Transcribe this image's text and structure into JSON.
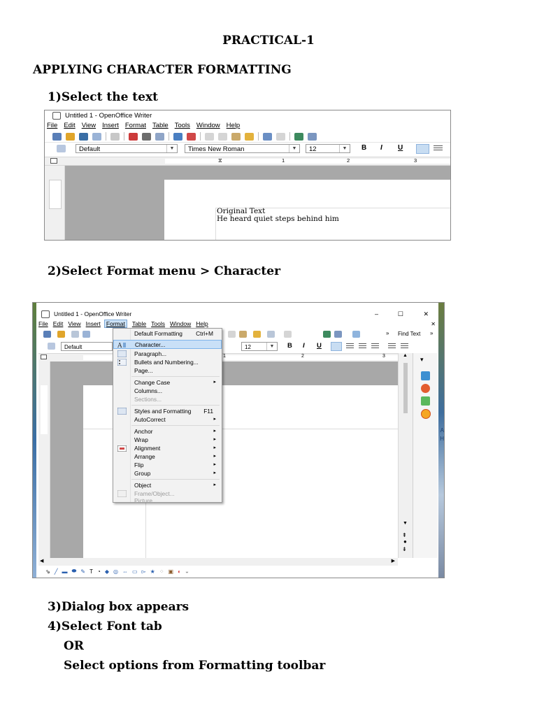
{
  "document": {
    "title": "PRACTICAL-1",
    "heading": "APPLYING CHARACTER FORMATTING",
    "steps": [
      {
        "num": "1)",
        "text": "Select the text"
      },
      {
        "num": "2)",
        "text": "Select Format menu > Character"
      },
      {
        "num": "3)",
        "text": "Dialog box appears"
      },
      {
        "num": "4)",
        "text": "Select Font tab"
      }
    ],
    "or_text": "OR",
    "alt_text": "Select options from Formatting toolbar"
  },
  "screenshot1": {
    "window_title": "Untitled 1 - OpenOffice Writer",
    "menu": [
      "File",
      "Edit",
      "View",
      "Insert",
      "Format",
      "Table",
      "Tools",
      "Window",
      "Help"
    ],
    "style_combo": "Default",
    "font_combo": "Times New Roman",
    "size_combo": "12",
    "bold": "B",
    "italic": "I",
    "underline": "U",
    "ruler_marks": [
      "1",
      "2",
      "3"
    ],
    "doc_lines": [
      "Original Text",
      "He heard quiet steps behind him"
    ]
  },
  "screenshot2": {
    "window_title": "Untitled 1 - OpenOffice Writer",
    "win_min": "–",
    "win_max": "☐",
    "win_close": "✕",
    "menu": [
      "File",
      "Edit",
      "View",
      "Insert",
      "Format",
      "Table",
      "Tools",
      "Window",
      "Help"
    ],
    "style_combo": "Default",
    "size_combo": "12",
    "find_text": "Find Text",
    "bold": "B",
    "italic": "I",
    "underline": "U",
    "ruler_marks": [
      "1",
      "2",
      "3"
    ],
    "format_menu": {
      "default_formatting": "Default Formatting",
      "default_shortcut": "Ctrl+M",
      "character": "Character...",
      "paragraph": "Paragraph...",
      "bullets": "Bullets and Numbering...",
      "page": "Page...",
      "change_case": "Change Case",
      "columns": "Columns...",
      "sections": "Sections...",
      "styles": "Styles and Formatting",
      "styles_shortcut": "F11",
      "autocorrect": "AutoCorrect",
      "anchor": "Anchor",
      "wrap": "Wrap",
      "alignment": "Alignment",
      "arrange": "Arrange",
      "flip": "Flip",
      "group": "Group",
      "object": "Object",
      "frame_object": "Frame/Object...",
      "picture": "Picture..."
    },
    "side_text_a": "A",
    "side_text_h": "H"
  }
}
